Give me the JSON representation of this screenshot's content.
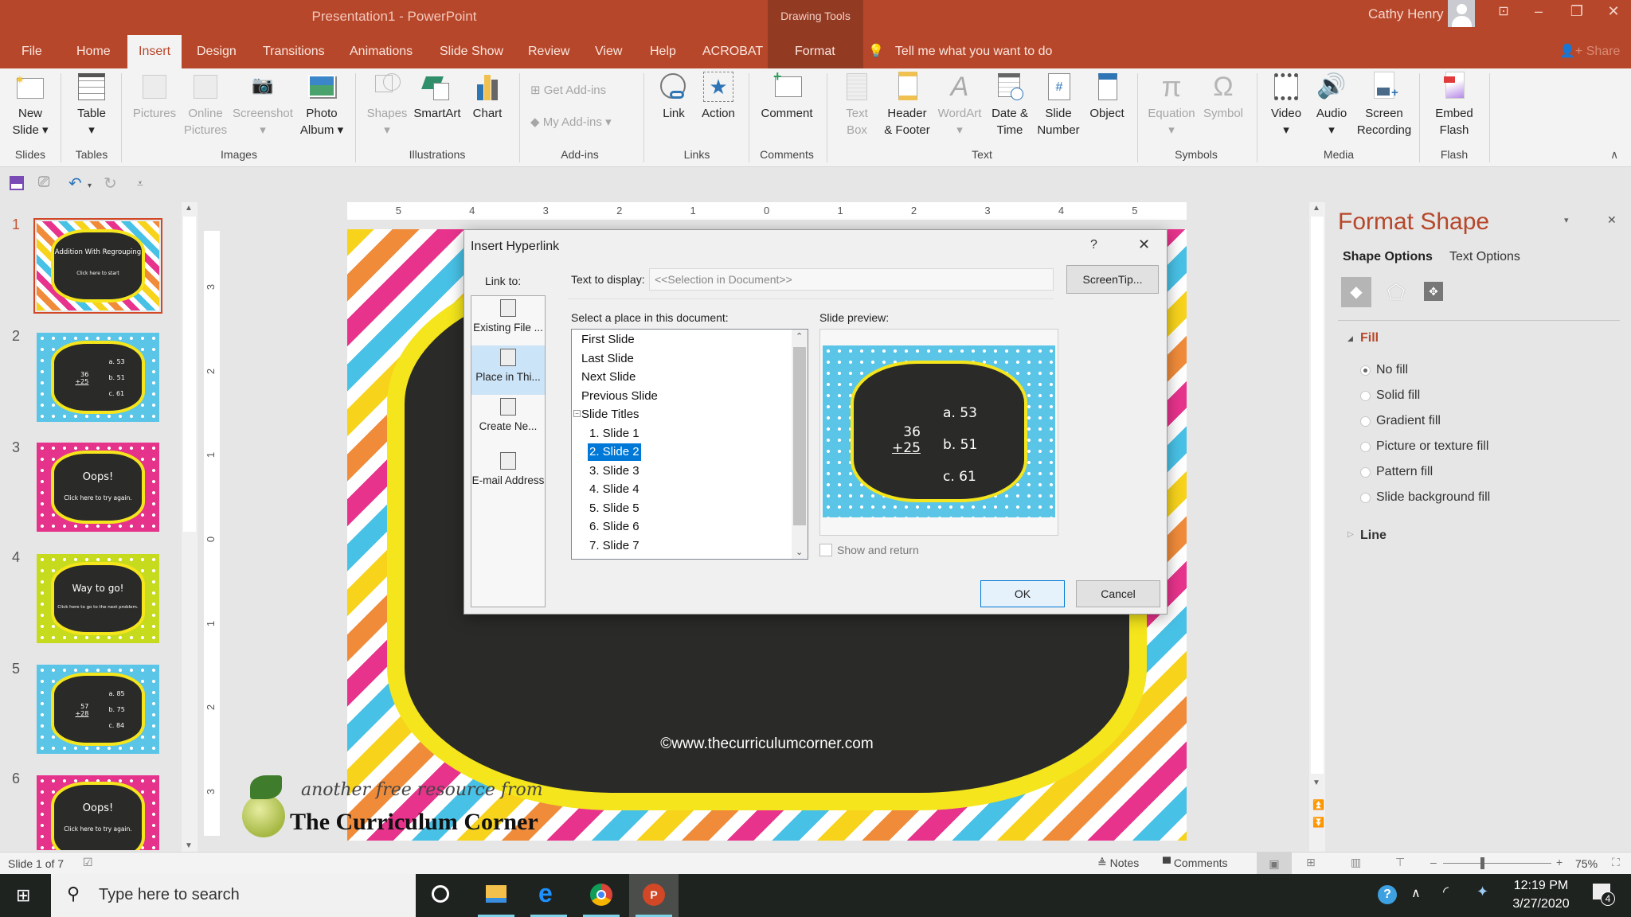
{
  "window": {
    "title": "Presentation1  -  PowerPoint",
    "context_tab_group": "Drawing Tools",
    "user_name": "Cathy Henry",
    "controls": {
      "ribbon_display": "ribbon-display-icon",
      "minimize": "–",
      "restore": "❐",
      "close": "✕"
    }
  },
  "tabs": [
    {
      "label": "File"
    },
    {
      "label": "Home"
    },
    {
      "label": "Insert",
      "active": true
    },
    {
      "label": "Design"
    },
    {
      "label": "Transitions"
    },
    {
      "label": "Animations"
    },
    {
      "label": "Slide Show"
    },
    {
      "label": "Review"
    },
    {
      "label": "View"
    },
    {
      "label": "Help"
    },
    {
      "label": "ACROBAT"
    },
    {
      "label": "Format"
    }
  ],
  "tell_me": "Tell me what you want to do",
  "share_label": "Share",
  "ribbon": {
    "groups": {
      "slides": "Slides",
      "tables": "Tables",
      "images": "Images",
      "illustrations": "Illustrations",
      "addins": "Add-ins",
      "links": "Links",
      "comments": "Comments",
      "text": "Text",
      "symbols": "Symbols",
      "media": "Media",
      "flash": "Flash"
    },
    "buttons": {
      "new_slide": "New\nSlide ▾",
      "table": "Table\n▾",
      "pictures": "Pictures",
      "online_pictures": "Online\nPictures",
      "screenshot": "Screenshot\n▾",
      "photo_album": "Photo\nAlbum ▾",
      "shapes": "Shapes\n▾",
      "smartart": "SmartArt",
      "chart": "Chart",
      "get_addins": "Get Add-ins",
      "my_addins": "My Add-ins  ▾",
      "link": "Link",
      "action": "Action",
      "comment": "Comment",
      "text_box": "Text\nBox",
      "header_footer": "Header\n& Footer",
      "wordart": "WordArt\n▾",
      "date_time": "Date &\nTime",
      "slide_number": "Slide\nNumber",
      "object": "Object",
      "equation": "Equation\n▾",
      "symbol": "Symbol",
      "video": "Video\n▾",
      "audio": "Audio\n▾",
      "screen_recording": "Screen\nRecording",
      "embed_flash": "Embed\nFlash"
    }
  },
  "thumbnails": [
    {
      "num": "1",
      "title": "Addition With Regrouping",
      "sub": "Click here to start",
      "theme": "chevron"
    },
    {
      "num": "2",
      "problem_top": "36",
      "problem_bottom": "+25",
      "choices": [
        "a. 53",
        "b. 51",
        "c. 61"
      ],
      "theme": "blue"
    },
    {
      "num": "3",
      "title": "Oops!",
      "sub": "Click here to try again.",
      "theme": "pink"
    },
    {
      "num": "4",
      "title": "Way to go!",
      "sub": "Click here to go to the next problem.",
      "theme": "green"
    },
    {
      "num": "5",
      "problem_top": "57",
      "problem_bottom": "+28",
      "choices": [
        "a. 85",
        "b. 75",
        "c. 84"
      ],
      "theme": "blue"
    },
    {
      "num": "6",
      "title": "Oops!",
      "sub": "Click here to try again.",
      "theme": "pink"
    }
  ],
  "ruler": {
    "horizontal": [
      "5",
      "4",
      "3",
      "2",
      "1",
      "0",
      "1",
      "2",
      "3",
      "4",
      "5"
    ],
    "vertical": [
      "3",
      "2",
      "1",
      "0",
      "1",
      "2",
      "3"
    ]
  },
  "slide": {
    "credit": "©www.thecurriculumcorner.com",
    "brand_line1": "another free resource from",
    "brand_line2": "The Curriculum Corner"
  },
  "dialog": {
    "title": "Insert Hyperlink",
    "help": "?",
    "close": "✕",
    "link_to_label": "Link to:",
    "link_to_items": [
      "Existing File ...",
      "Place in Thi...",
      "Create Ne...",
      "E-mail Address"
    ],
    "text_to_display_label": "Text to display:",
    "text_to_display_value": "<<Selection in Document>>",
    "screentip_button": "ScreenTip...",
    "select_place_label": "Select a place in this document:",
    "places": [
      "First Slide",
      "Last Slide",
      "Next Slide",
      "Previous Slide",
      "Slide Titles",
      "1. Slide 1",
      "2. Slide 2",
      "3. Slide 3",
      "4. Slide 4",
      "5. Slide 5",
      "6. Slide 6",
      "7. Slide 7"
    ],
    "selected_place": "2. Slide 2",
    "slide_preview_label": "Slide preview:",
    "preview": {
      "problem_top": "36",
      "problem_bottom": "+25",
      "choices": [
        "a. 53",
        "b. 51",
        "c. 61"
      ]
    },
    "show_and_return_label": "Show and return",
    "show_and_return_checked": false,
    "ok_button": "OK",
    "cancel_button": "Cancel"
  },
  "format_pane": {
    "title": "Format Shape",
    "tabs": [
      "Shape Options",
      "Text Options"
    ],
    "active_tab": "Shape Options",
    "fill_section": "Fill",
    "fill_options": [
      "No fill",
      "Solid fill",
      "Gradient fill",
      "Picture or texture fill",
      "Pattern fill",
      "Slide background fill"
    ],
    "selected_fill": "No fill",
    "line_section": "Line"
  },
  "status_bar": {
    "slide_counter": "Slide 1 of 7",
    "notes": "Notes",
    "comments": "Comments",
    "zoom_minus": "–",
    "zoom_plus": "+",
    "zoom": "75%",
    "zoom_fraction": 0.75
  },
  "taskbar": {
    "search_placeholder": "Type here to search",
    "time": "12:19 PM",
    "date": "3/27/2020",
    "notification_count": "4"
  },
  "colors": {
    "accent": "#b7472a",
    "selection": "#0078d7",
    "pane_title": "#b7472a"
  }
}
